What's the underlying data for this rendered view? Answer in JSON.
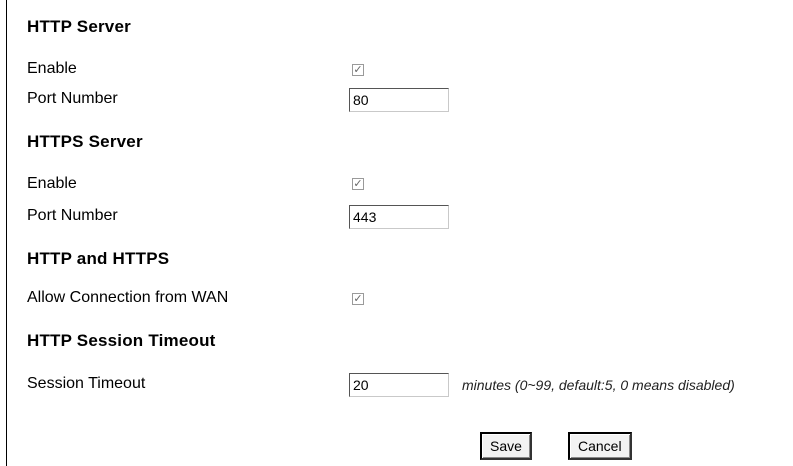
{
  "http_server": {
    "title": "HTTP Server",
    "enable_label": "Enable",
    "enable_checked": true,
    "port_label": "Port Number",
    "port_value": "80"
  },
  "https_server": {
    "title": "HTTPS Server",
    "enable_label": "Enable",
    "enable_checked": true,
    "port_label": "Port Number",
    "port_value": "443"
  },
  "http_and_https": {
    "title": "HTTP and HTTPS",
    "wan_label": "Allow Connection from WAN",
    "wan_checked": true
  },
  "session_timeout": {
    "title": "HTTP Session Timeout",
    "label": "Session Timeout",
    "value": "20",
    "hint": "minutes (0~99, default:5, 0 means disabled)"
  },
  "actions": {
    "save_label": "Save",
    "cancel_label": "Cancel"
  },
  "check_mark": "✓"
}
